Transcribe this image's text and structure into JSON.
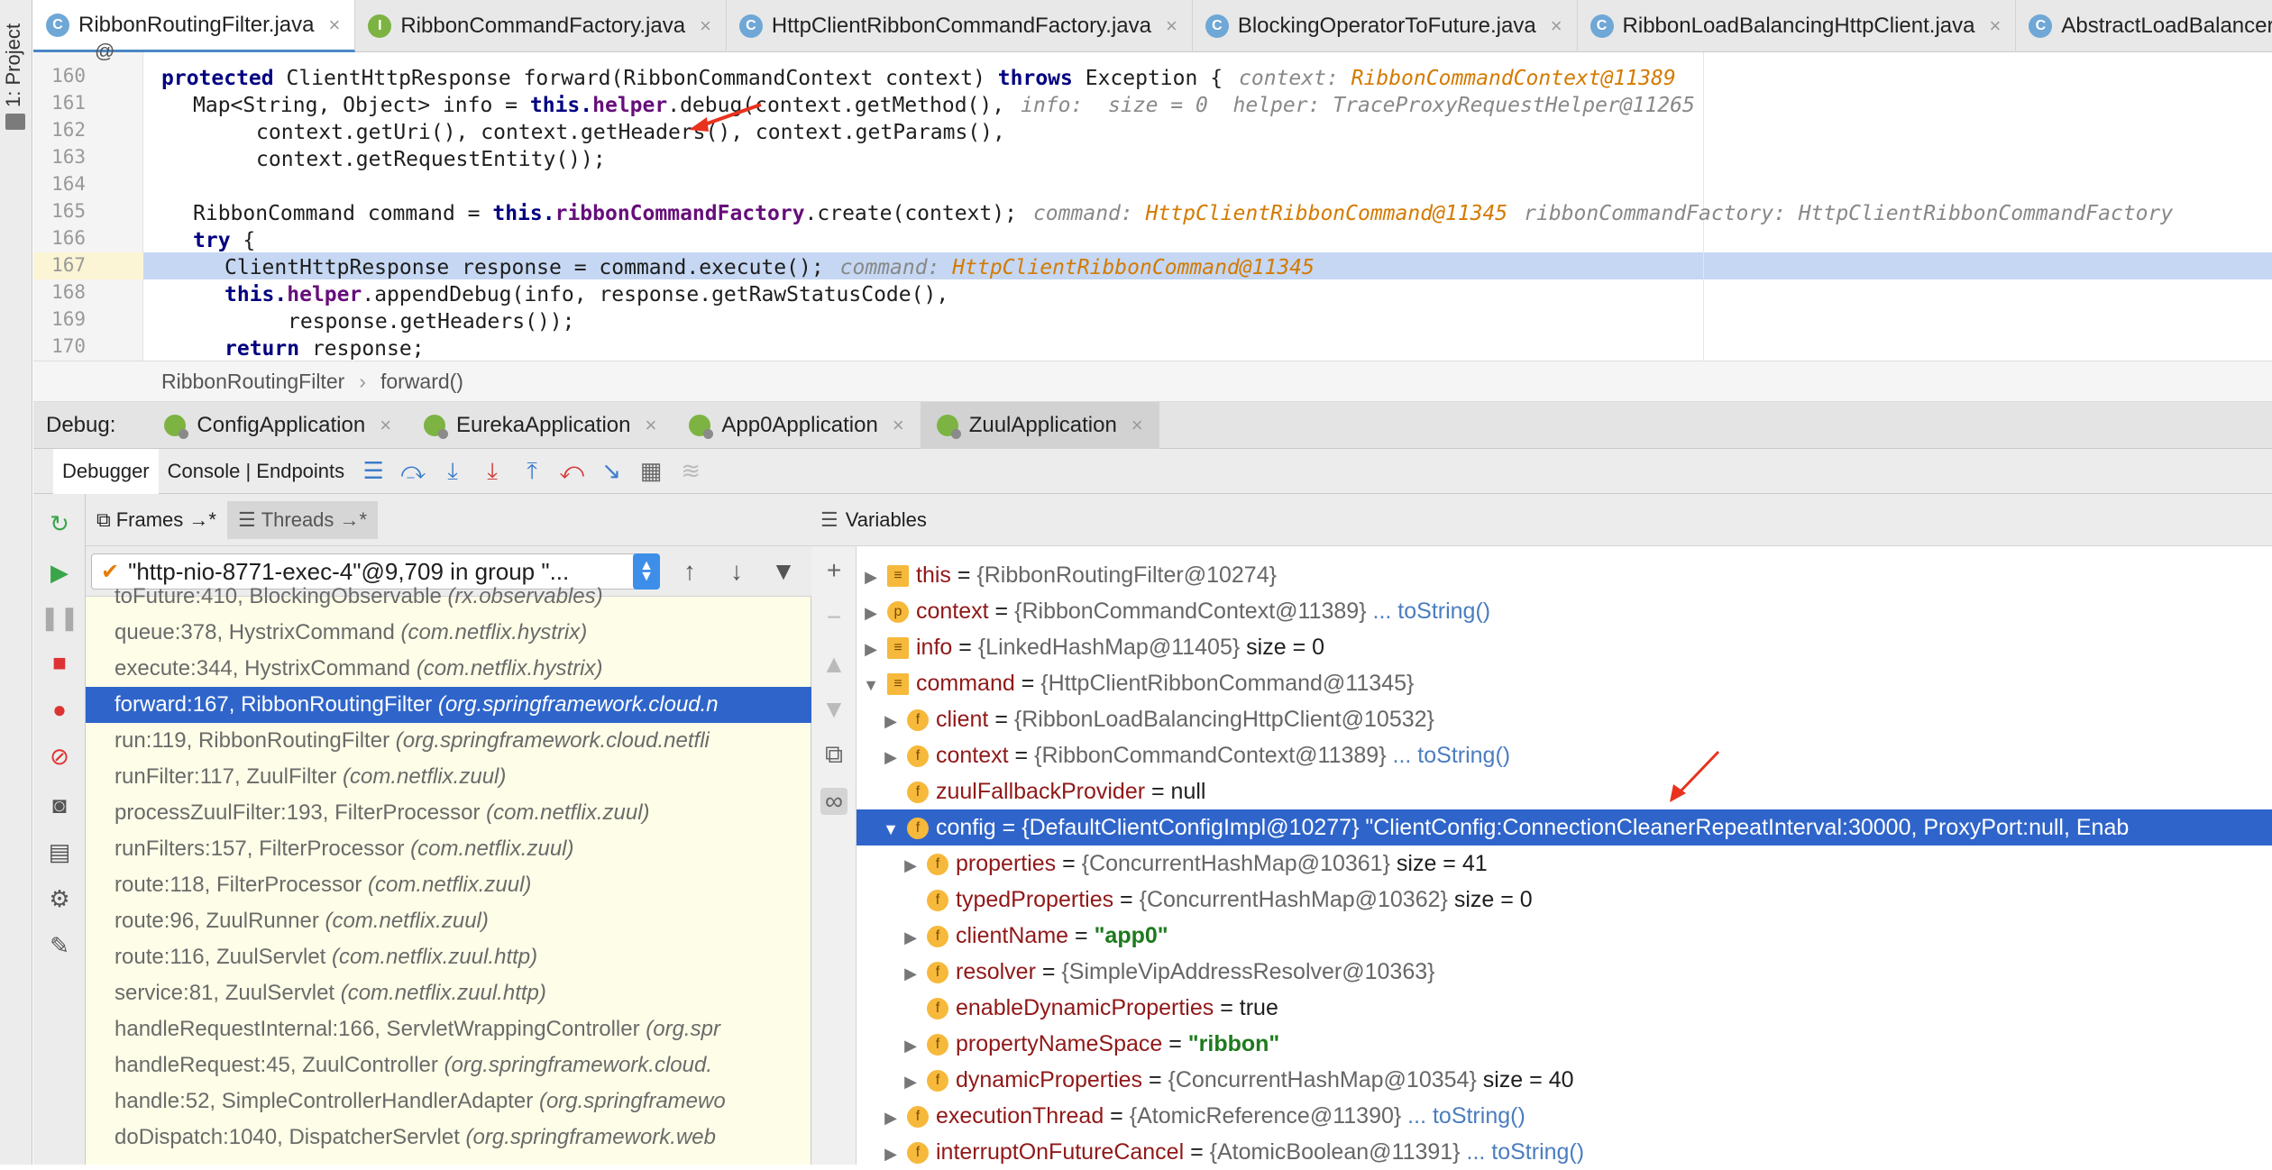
{
  "left_strip": {
    "label": "1: Project"
  },
  "tabs": [
    {
      "label": "RibbonRoutingFilter.java",
      "icon": "class-icon",
      "active": true
    },
    {
      "label": "RibbonCommandFactory.java",
      "icon": "interface-icon"
    },
    {
      "label": "HttpClientRibbonCommandFactory.java",
      "icon": "class-icon"
    },
    {
      "label": "BlockingOperatorToFuture.java",
      "icon": "class-icon"
    },
    {
      "label": "RibbonLoadBalancingHttpClient.java",
      "icon": "class-icon"
    },
    {
      "label": "AbstractLoadBalancerAwar",
      "icon": "class-icon"
    }
  ],
  "editor": {
    "line_numbers": [
      "160",
      "161",
      "162",
      "163",
      "164",
      "165",
      "166",
      "167",
      "168",
      "169",
      "170"
    ],
    "annotation_at": "@",
    "lines": {
      "l160": {
        "kw1": "protected ",
        "t1": "ClientHttpResponse forward(RibbonCommandContext context) ",
        "kw2": "throws ",
        "t2": "Exception {",
        "hint": "context: ",
        "hval": "RibbonCommandContext@11389"
      },
      "l161": {
        "t1": "Map<String, Object> info = ",
        "kw1": "this.",
        "f1": "helper",
        "t2": ".debug(context.getMethod(),",
        "hint": "info:  size = 0  helper: TraceProxyRequestHelper@11265"
      },
      "l162": {
        "t1": "context.getUri(), context.getHeaders(), context.getParams(),"
      },
      "l163": {
        "t1": "context.getRequestEntity());"
      },
      "l165": {
        "t1": "RibbonCommand command = ",
        "kw1": "this.",
        "f1": "ribbonCommandFactory",
        "t2": ".create(context);",
        "hint": "command: ",
        "hval": "HttpClientRibbonCommand@11345",
        "hint2": "ribbonCommandFactory: HttpClientRibbonCommandFactory"
      },
      "l166": {
        "kw1": "try ",
        "t1": "{"
      },
      "l167": {
        "t1": "ClientHttpResponse response = command.execute();",
        "hint": "command: ",
        "hval": "HttpClientRibbonCommand@11345"
      },
      "l168": {
        "kw1": "this.",
        "f1": "helper",
        "t1": ".appendDebug(info, response.getRawStatusCode(),"
      },
      "l169": {
        "t1": "response.getHeaders());"
      },
      "l170": {
        "kw1": "return ",
        "t1": "response;"
      }
    }
  },
  "breadcrumb": {
    "class": "RibbonRoutingFilter",
    "sep": "›",
    "method": "forward()"
  },
  "debug_bar": {
    "label": "Debug:",
    "tabs": [
      {
        "label": "ConfigApplication"
      },
      {
        "label": "EurekaApplication"
      },
      {
        "label": "App0Application"
      },
      {
        "label": "ZuulApplication",
        "active": true
      }
    ]
  },
  "toolbar": {
    "debugger": "Debugger",
    "console": "Console | Endpoints"
  },
  "frames": {
    "frames_tab": "Frames →*",
    "threads_tab": "Threads →*",
    "thread": "\"http-nio-8771-exec-4\"@9,709 in group \"...",
    "rows": [
      {
        "method": "toFuture:410, BlockingObservable",
        "pkg": "(rx.observables)"
      },
      {
        "method": "queue:378, HystrixCommand",
        "pkg": "(com.netflix.hystrix)"
      },
      {
        "method": "execute:344, HystrixCommand",
        "pkg": "(com.netflix.hystrix)"
      },
      {
        "method": "forward:167, RibbonRoutingFilter",
        "pkg": "(org.springframework.cloud.n",
        "selected": true
      },
      {
        "method": "run:119, RibbonRoutingFilter",
        "pkg": "(org.springframework.cloud.netfli"
      },
      {
        "method": "runFilter:117, ZuulFilter",
        "pkg": "(com.netflix.zuul)"
      },
      {
        "method": "processZuulFilter:193, FilterProcessor",
        "pkg": "(com.netflix.zuul)"
      },
      {
        "method": "runFilters:157, FilterProcessor",
        "pkg": "(com.netflix.zuul)"
      },
      {
        "method": "route:118, FilterProcessor",
        "pkg": "(com.netflix.zuul)"
      },
      {
        "method": "route:96, ZuulRunner",
        "pkg": "(com.netflix.zuul)"
      },
      {
        "method": "route:116, ZuulServlet",
        "pkg": "(com.netflix.zuul.http)"
      },
      {
        "method": "service:81, ZuulServlet",
        "pkg": "(com.netflix.zuul.http)"
      },
      {
        "method": "handleRequestInternal:166, ServletWrappingController",
        "pkg": "(org.spr"
      },
      {
        "method": "handleRequest:45, ZuulController",
        "pkg": "(org.springframework.cloud."
      },
      {
        "method": "handle:52, SimpleControllerHandlerAdapter",
        "pkg": "(org.springframewo"
      },
      {
        "method": "doDispatch:1040, DispatcherServlet",
        "pkg": "(org.springframework.web"
      }
    ]
  },
  "variables": {
    "header": "Variables",
    "rows": [
      {
        "indent": 0,
        "tri": "▶",
        "badge": "≡",
        "name": "this",
        "eq": " = ",
        "ref": "{RibbonRoutingFilter@10274}"
      },
      {
        "indent": 0,
        "tri": "▶",
        "badge": "p",
        "name": "context",
        "eq": " = ",
        "ref": "{RibbonCommandContext@11389}",
        "link": " ... toString()"
      },
      {
        "indent": 0,
        "tri": "▶",
        "badge": "≡",
        "name": "info",
        "eq": " = ",
        "ref": "{LinkedHashMap@11405}",
        "extra": "  size = 0"
      },
      {
        "indent": 0,
        "tri": "▼",
        "badge": "≡",
        "name": "command",
        "eq": " = ",
        "ref": "{HttpClientRibbonCommand@11345}"
      },
      {
        "indent": 1,
        "tri": "▶",
        "badge": "f",
        "name": "client",
        "eq": " = ",
        "ref": "{RibbonLoadBalancingHttpClient@10532}"
      },
      {
        "indent": 1,
        "tri": "▶",
        "badge": "f",
        "name": "context",
        "eq": " = ",
        "ref": "{RibbonCommandContext@11389}",
        "link": " ... toString()"
      },
      {
        "indent": 1,
        "tri": "",
        "badge": "f",
        "name": "zuulFallbackProvider",
        "eq": " = ",
        "val": "null"
      },
      {
        "indent": 1,
        "tri": "▼",
        "badge": "f",
        "name": "config",
        "eq": " = ",
        "ref": "{DefaultClientConfigImpl@10277}",
        "str": " \"ClientConfig:ConnectionCleanerRepeatInterval:30000, ProxyPort:null, Enab",
        "selected": true
      },
      {
        "indent": 2,
        "tri": "▶",
        "badge": "f",
        "name": "properties",
        "eq": " = ",
        "ref": "{ConcurrentHashMap@10361}",
        "extra": "  size = 41"
      },
      {
        "indent": 2,
        "tri": "",
        "badge": "f",
        "name": "typedProperties",
        "eq": " = ",
        "ref": "{ConcurrentHashMap@10362}",
        "extra": "  size = 0"
      },
      {
        "indent": 2,
        "tri": "▶",
        "badge": "f",
        "name": "clientName",
        "eq": " = ",
        "str": "\"app0\""
      },
      {
        "indent": 2,
        "tri": "▶",
        "badge": "f",
        "name": "resolver",
        "eq": " = ",
        "ref": "{SimpleVipAddressResolver@10363}"
      },
      {
        "indent": 2,
        "tri": "",
        "badge": "f",
        "name": "enableDynamicProperties",
        "eq": " = ",
        "val": "true"
      },
      {
        "indent": 2,
        "tri": "▶",
        "badge": "f",
        "name": "propertyNameSpace",
        "eq": " = ",
        "str": "\"ribbon\""
      },
      {
        "indent": 2,
        "tri": "▶",
        "badge": "f",
        "name": "dynamicProperties",
        "eq": " = ",
        "ref": "{ConcurrentHashMap@10354}",
        "extra": "  size = 40"
      },
      {
        "indent": 1,
        "tri": "▶",
        "badge": "f",
        "name": "executionThread",
        "eq": " = ",
        "ref": "{AtomicReference@11390}",
        "link": " ... toString()"
      },
      {
        "indent": 1,
        "tri": "▶",
        "badge": "f",
        "name": "interruptOnFutureCancel",
        "eq": " = ",
        "ref": "{AtomicBoolean@11391}",
        "link": " ... toString()"
      }
    ]
  },
  "colors": {
    "accent": "#2f65ca",
    "arrow": "#e8321e"
  }
}
